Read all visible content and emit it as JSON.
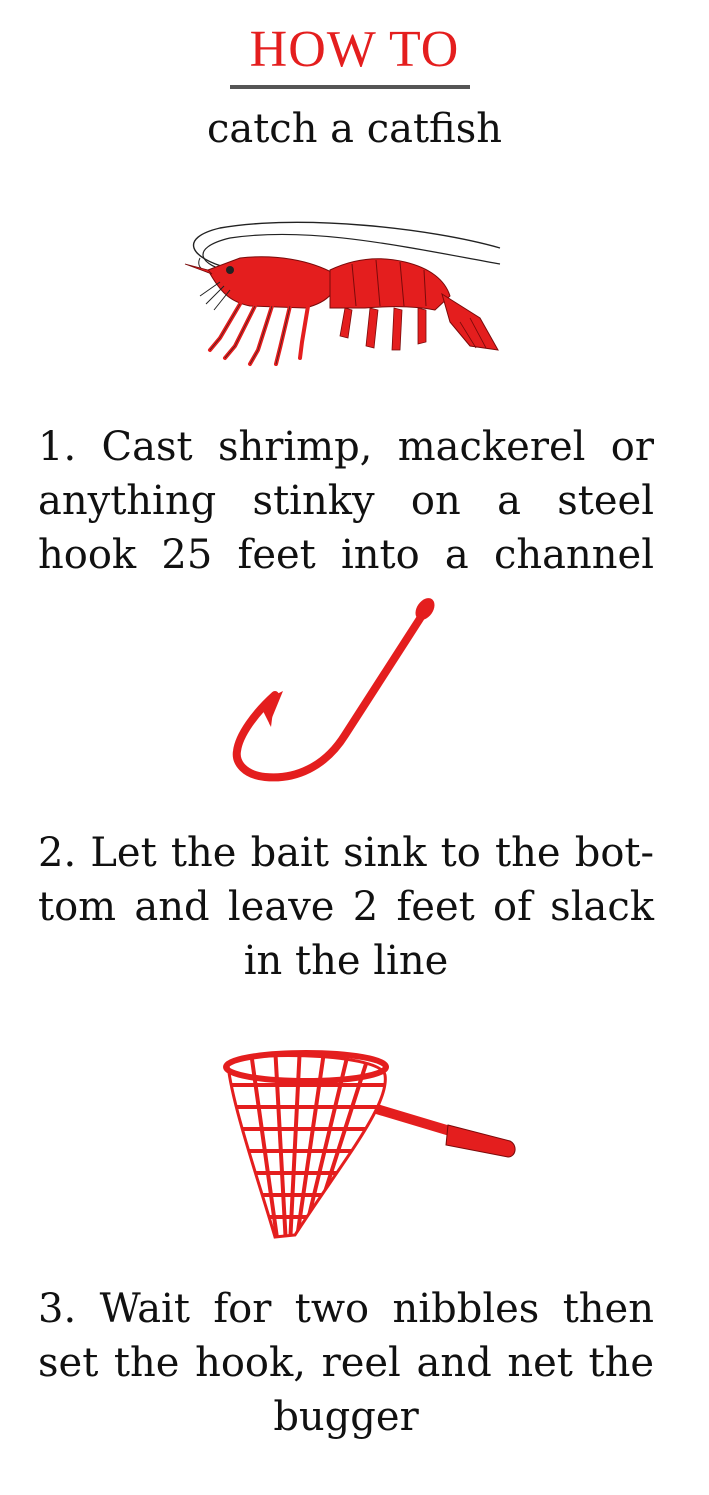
{
  "header": {
    "title": "HOW TO",
    "subtitle": "catch a catfish"
  },
  "colors": {
    "accent": "#e41e1e",
    "text": "#111111",
    "rule": "#555555",
    "sketch": "#222222"
  },
  "illustrations": {
    "step1": "shrimp-icon",
    "step2": "fish-hook-icon",
    "step3": "landing-net-icon"
  },
  "steps": [
    {
      "text": "1. Cast shrimp, mackerel or anything stinky on a steel hook 25 feet into a channel"
    },
    {
      "text": "2. Let the bait sink to the bot-tom and leave 2 feet of slack in the line"
    },
    {
      "text": "3. Wait for two nibbles then set the hook, reel and net the bugger"
    }
  ]
}
